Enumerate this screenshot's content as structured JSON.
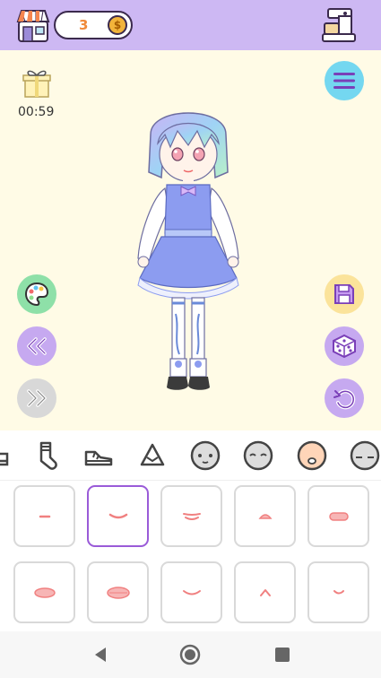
{
  "topbar": {
    "coins": "3",
    "coin_symbol": "$"
  },
  "timer": "00:59",
  "colors": {
    "topbar": "#cdb8f3",
    "background": "#fffbe6",
    "selected_tile": "#9a5bd8",
    "menu": "#74d7f0",
    "palette": "#8ee0a8",
    "purple_button": "#c6a9f0",
    "save": "#fbe39a"
  },
  "category_icons": [
    "shoe-partial-icon",
    "sock-icon",
    "sneaker-icon",
    "bag-icon",
    "face-base-icon",
    "face-closed-icon",
    "mouth-face-icon",
    "face-sleepy-icon"
  ],
  "selected_category": "mouth-face-icon",
  "mouth_options": [
    "small-line",
    "smile",
    "wide-smile",
    "small-open",
    "open-flat",
    "oval-open",
    "big-open",
    "gentle-smile",
    "caret",
    "tiny-smile"
  ],
  "selected_mouth_index": 1
}
